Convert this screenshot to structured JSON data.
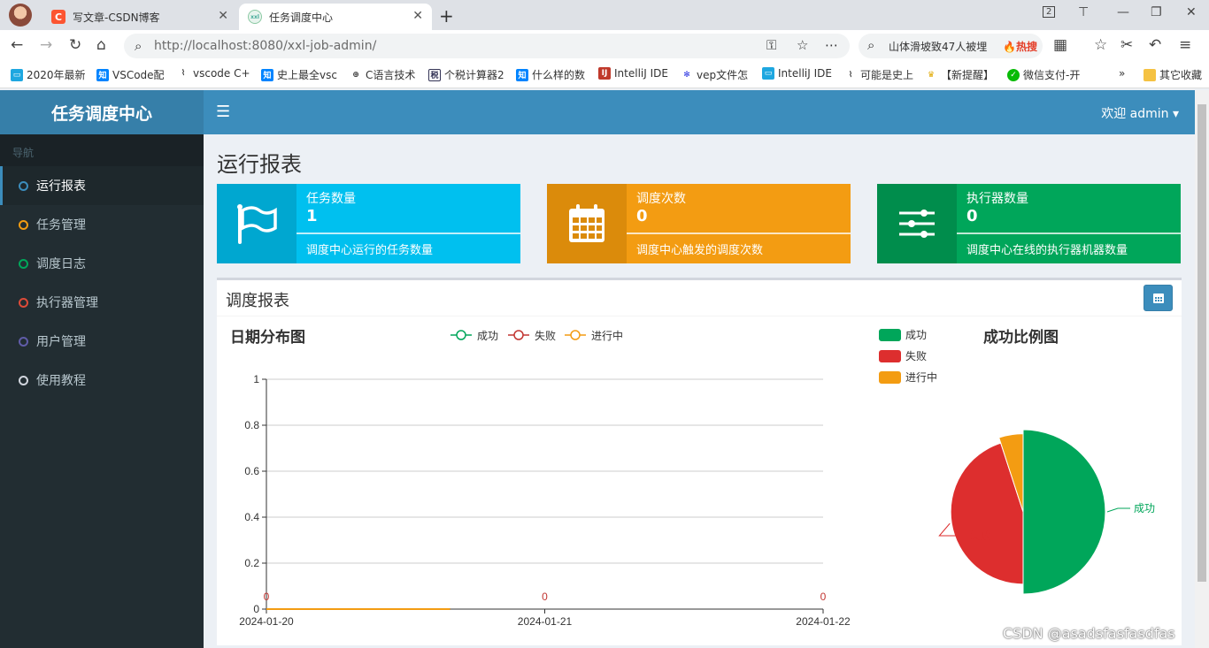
{
  "browser": {
    "tabs": [
      {
        "label": "写文章-CSDN博客",
        "fav": "C"
      },
      {
        "label": "任务调度中心",
        "fav": "xxl"
      }
    ],
    "url": "http://localhost:8080/xxl-job-admin/",
    "search_text": "山体滑坡致47人被埋",
    "search_badge": "🔥热搜",
    "tab_count": "2",
    "bookmarks": [
      "2020年最新",
      "VSCode配",
      "vscode C+",
      "史上最全vsc",
      "C语言技术",
      "个税计算器2",
      "什么样的数",
      "IntelliJ IDE",
      "vep文件怎",
      "IntelliJ IDE",
      "可能是史上",
      "【新提醒】",
      "微信支付-开",
      "其它收藏"
    ],
    "bookmark_more": "»"
  },
  "app": {
    "logo": "任务调度中心",
    "user_menu": "欢迎 admin ▾",
    "sidebar_header": "导航",
    "sidebar": [
      {
        "label": "运行报表",
        "color": "#3c8dbc",
        "active": true
      },
      {
        "label": "任务管理",
        "color": "#f39c12"
      },
      {
        "label": "调度日志",
        "color": "#00a65a"
      },
      {
        "label": "执行器管理",
        "color": "#dd4b39"
      },
      {
        "label": "用户管理",
        "color": "#605ca8"
      },
      {
        "label": "使用教程",
        "color": "#d2d6de"
      }
    ],
    "page_title": "运行报表",
    "info_boxes": [
      {
        "title": "任务数量",
        "value": "1",
        "desc": "调度中心运行的任务数量",
        "bg": "#00c0ef",
        "icon_bg": "#00a7d0",
        "icon": "flag-icon"
      },
      {
        "title": "调度次数",
        "value": "0",
        "desc": "调度中心触发的调度次数",
        "bg": "#f39c12",
        "icon_bg": "#db8b0b",
        "icon": "calendar-icon"
      },
      {
        "title": "执行器数量",
        "value": "0",
        "desc": "调度中心在线的执行器机器数量",
        "bg": "#00a65a",
        "icon_bg": "#008d4c",
        "icon": "sliders-icon"
      }
    ],
    "panel_title": "调度报表"
  },
  "watermark": "CSDN @asadsfasfasdfas",
  "chart_data": [
    {
      "type": "line",
      "title": "日期分布图",
      "x": [
        "2024-01-20",
        "2024-01-21",
        "2024-01-22"
      ],
      "series": [
        {
          "name": "成功",
          "values": [
            0,
            0,
            0
          ],
          "color": "#00a65a"
        },
        {
          "name": "失败",
          "values": [
            0,
            0,
            0
          ],
          "color": "#c23531"
        },
        {
          "name": "进行中",
          "values": [
            0,
            0,
            0
          ],
          "color": "#f39c12"
        }
      ],
      "ylim": [
        0,
        1
      ],
      "yticks": [
        "0",
        "0.2",
        "0.4",
        "0.6",
        "0.8",
        "1"
      ],
      "data_labels": [
        "0",
        "0",
        "0"
      ],
      "legend": "top-center",
      "grid": true
    },
    {
      "type": "pie",
      "title": "成功比例图",
      "legend": "top-left",
      "slices": [
        {
          "name": "成功",
          "value": 0.5,
          "color": "#00a65a"
        },
        {
          "name": "失败",
          "value": 0.45,
          "color": "#dd2e2e"
        },
        {
          "name": "进行中",
          "value": 0.05,
          "color": "#f39c12"
        }
      ],
      "slice_labels": [
        "成功",
        "失败"
      ]
    }
  ]
}
